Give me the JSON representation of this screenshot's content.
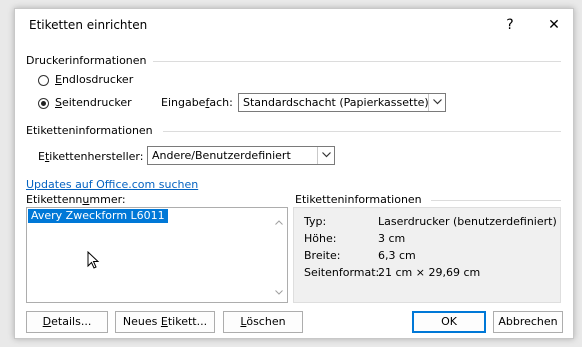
{
  "dialog": {
    "title": "Etiketten einrichten",
    "help_label": "?",
    "close_label": "✕"
  },
  "printer_info": {
    "heading": "Druckerinformationen",
    "continuous": {
      "before": "",
      "mnemonic": "E",
      "after": "ndlosdrucker",
      "selected": false
    },
    "page": {
      "before": "",
      "mnemonic": "S",
      "after": "eitendrucker",
      "selected": true
    },
    "tray_label": {
      "before": "Eingabe",
      "mnemonic": "f",
      "after": "ach:"
    },
    "tray_value": "Standardschacht (Papierkassette)"
  },
  "label_info": {
    "heading": "Etiketteninformationen",
    "vendor_label": {
      "before": "E",
      "mnemonic": "t",
      "after": "ikettenhersteller:"
    },
    "vendor_value": "Andere/Benutzerdefiniert",
    "updates_link": "Updates auf Office.com suchen",
    "product_label": {
      "before": "Etikettenn",
      "mnemonic": "u",
      "after": "mmer:"
    },
    "products": [
      "Avery Zweckform L6011"
    ]
  },
  "details_panel": {
    "heading": "Etiketteninformationen",
    "rows": [
      {
        "key": "Typ:",
        "value": "Laserdrucker (benutzerdefiniert)"
      },
      {
        "key": "Höhe:",
        "value": "3 cm"
      },
      {
        "key": "Breite:",
        "value": "6,3 cm"
      },
      {
        "key": "Seitenformat:",
        "value": "21 cm × 29,69 cm"
      }
    ]
  },
  "buttons": {
    "details": {
      "before": "",
      "mnemonic": "D",
      "after": "etails..."
    },
    "new_label": {
      "before": "Neues ",
      "mnemonic": "E",
      "after": "tikett..."
    },
    "delete": {
      "before": "",
      "mnemonic": "L",
      "after": "öschen"
    },
    "ok": "OK",
    "cancel": "Abbrechen"
  }
}
